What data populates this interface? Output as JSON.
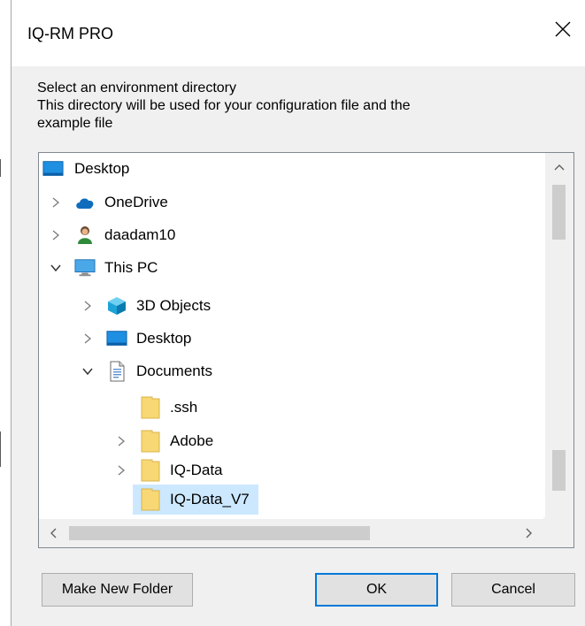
{
  "window": {
    "title": "IQ-RM PRO",
    "close_glyph": "✕"
  },
  "description": {
    "line1": "Select an environment directory",
    "line2": "This directory will be used for your configuration file and the",
    "line3": "example file"
  },
  "tree": {
    "items": [
      {
        "label": "Desktop",
        "icon": "desktop-icon",
        "expander": "none",
        "selected": false
      },
      {
        "label": "OneDrive",
        "icon": "onedrive-icon",
        "expander": "collapsed",
        "selected": false
      },
      {
        "label": "daadam10",
        "icon": "user-icon",
        "expander": "collapsed",
        "selected": false
      },
      {
        "label": "This PC",
        "icon": "computer-icon",
        "expander": "expanded",
        "selected": false
      },
      {
        "label": "3D Objects",
        "icon": "3d-objects-icon",
        "expander": "collapsed",
        "selected": false
      },
      {
        "label": "Desktop",
        "icon": "desktop-icon",
        "expander": "collapsed",
        "selected": false
      },
      {
        "label": "Documents",
        "icon": "documents-icon",
        "expander": "expanded",
        "selected": false
      },
      {
        "label": ".ssh",
        "icon": "folder-icon",
        "expander": "none",
        "selected": false
      },
      {
        "label": "Adobe",
        "icon": "folder-icon",
        "expander": "collapsed",
        "selected": false
      },
      {
        "label": "IQ-Data",
        "icon": "folder-icon",
        "expander": "collapsed",
        "selected": false
      },
      {
        "label": "IQ-Data_V7",
        "icon": "folder-icon",
        "expander": "none",
        "selected": true
      }
    ]
  },
  "buttons": {
    "make_new_folder": "Make New Folder",
    "ok": "OK",
    "cancel": "Cancel"
  },
  "colors": {
    "selection": "#cce8ff",
    "accent": "#0078d7",
    "folder": "#f8d775"
  }
}
